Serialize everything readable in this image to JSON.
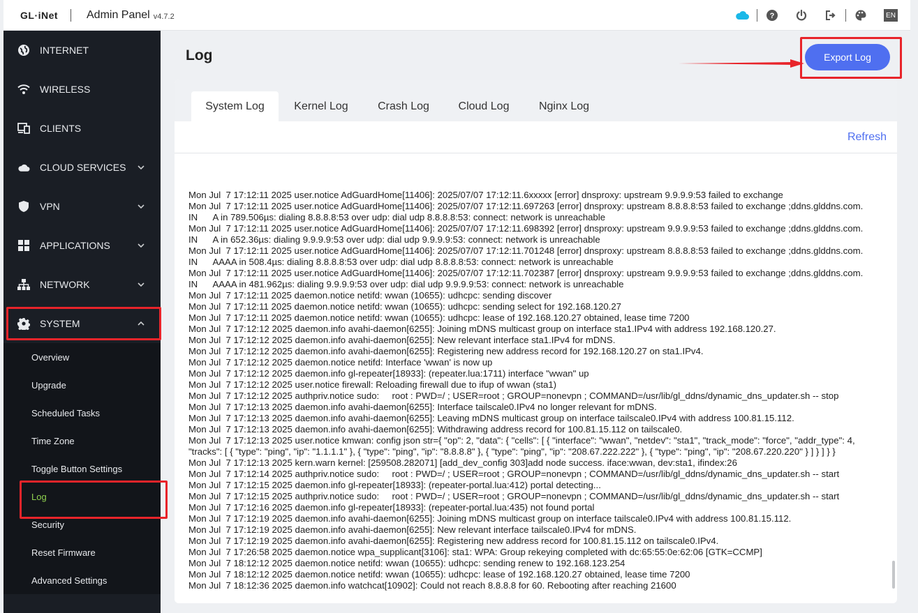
{
  "header": {
    "logo": "GL·iNet",
    "title": "Admin Panel",
    "version": "v4.7.2",
    "lang": "EN",
    "icons": [
      "cloud-icon",
      "help-icon",
      "power-icon",
      "logout-icon",
      "theme-icon"
    ],
    "cloud_color": "#1ab8e8"
  },
  "sidebar": {
    "items": [
      {
        "label": "INTERNET",
        "icon": "globe-icon"
      },
      {
        "label": "WIRELESS",
        "icon": "wifi-icon"
      },
      {
        "label": "CLIENTS",
        "icon": "devices-icon"
      },
      {
        "label": "CLOUD SERVICES",
        "icon": "cloud-icon"
      },
      {
        "label": "VPN",
        "icon": "shield-icon"
      },
      {
        "label": "APPLICATIONS",
        "icon": "apps-icon"
      },
      {
        "label": "NETWORK",
        "icon": "network-icon"
      },
      {
        "label": "SYSTEM",
        "icon": "gear-icon"
      }
    ],
    "system_sub": [
      "Overview",
      "Upgrade",
      "Scheduled Tasks",
      "Time Zone",
      "Toggle Button Settings",
      "Log",
      "Security",
      "Reset Firmware",
      "Advanced Settings"
    ],
    "active_sub": "Log",
    "active_color": "#8fd14f"
  },
  "main": {
    "title": "Log",
    "export_label": "Export Log",
    "refresh_label": "Refresh",
    "tabs": [
      "System Log",
      "Kernel Log",
      "Crash Log",
      "Cloud Log",
      "Nginx Log"
    ],
    "active_tab": "System Log",
    "accent": "#4f6ff0"
  },
  "log": [
    "Mon Jul  7 17:12:11 2025 user.notice AdGuardHome[11406]: 2025/07/07 17:12:11.6xxxxx [error] dnsproxy: upstream 9.9.9.9:53 failed to exchange",
    "Mon Jul  7 17:12:11 2025 user.notice AdGuardHome[11406]: 2025/07/07 17:12:11.697263 [error] dnsproxy: upstream 8.8.8.8:53 failed to exchange ;ddns.glddns.com.    IN      A in 789.506µs: dialing 8.8.8.8:53 over udp: dial udp 8.8.8.8:53: connect: network is unreachable",
    "Mon Jul  7 17:12:11 2025 user.notice AdGuardHome[11406]: 2025/07/07 17:12:11.698392 [error] dnsproxy: upstream 9.9.9.9:53 failed to exchange ;ddns.glddns.com.    IN      A in 652.36µs: dialing 9.9.9.9:53 over udp: dial udp 9.9.9.9:53: connect: network is unreachable",
    "Mon Jul  7 17:12:11 2025 user.notice AdGuardHome[11406]: 2025/07/07 17:12:11.701248 [error] dnsproxy: upstream 8.8.8.8:53 failed to exchange ;ddns.glddns.com.    IN      AAAA in 508.4µs: dialing 8.8.8.8:53 over udp: dial udp 8.8.8.8:53: connect: network is unreachable",
    "Mon Jul  7 17:12:11 2025 user.notice AdGuardHome[11406]: 2025/07/07 17:12:11.702387 [error] dnsproxy: upstream 9.9.9.9:53 failed to exchange ;ddns.glddns.com.    IN      AAAA in 481.962µs: dialing 9.9.9.9:53 over udp: dial udp 9.9.9.9:53: connect: network is unreachable",
    "Mon Jul  7 17:12:11 2025 daemon.notice netifd: wwan (10655): udhcpc: sending discover",
    "Mon Jul  7 17:12:11 2025 daemon.notice netifd: wwan (10655): udhcpc: sending select for 192.168.120.27",
    "Mon Jul  7 17:12:11 2025 daemon.notice netifd: wwan (10655): udhcpc: lease of 192.168.120.27 obtained, lease time 7200",
    "Mon Jul  7 17:12:12 2025 daemon.info avahi-daemon[6255]: Joining mDNS multicast group on interface sta1.IPv4 with address 192.168.120.27.",
    "Mon Jul  7 17:12:12 2025 daemon.info avahi-daemon[6255]: New relevant interface sta1.IPv4 for mDNS.",
    "Mon Jul  7 17:12:12 2025 daemon.info avahi-daemon[6255]: Registering new address record for 192.168.120.27 on sta1.IPv4.",
    "Mon Jul  7 17:12:12 2025 daemon.notice netifd: Interface 'wwan' is now up",
    "Mon Jul  7 17:12:12 2025 daemon.info gl-repeater[18933]: (repeater.lua:1711) interface \"wwan\" up",
    "Mon Jul  7 17:12:12 2025 user.notice firewall: Reloading firewall due to ifup of wwan (sta1)",
    "Mon Jul  7 17:12:12 2025 authpriv.notice sudo:     root : PWD=/ ; USER=root ; GROUP=nonevpn ; COMMAND=/usr/lib/gl_ddns/dynamic_dns_updater.sh -- stop",
    "Mon Jul  7 17:12:13 2025 daemon.info avahi-daemon[6255]: Interface tailscale0.IPv4 no longer relevant for mDNS.",
    "Mon Jul  7 17:12:13 2025 daemon.info avahi-daemon[6255]: Leaving mDNS multicast group on interface tailscale0.IPv4 with address 100.81.15.112.",
    "Mon Jul  7 17:12:13 2025 daemon.info avahi-daemon[6255]: Withdrawing address record for 100.81.15.112 on tailscale0.",
    "Mon Jul  7 17:12:13 2025 user.notice kmwan: config json str={ \"op\": 2, \"data\": { \"cells\": [ { \"interface\": \"wwan\", \"netdev\": \"sta1\", \"track_mode\": \"force\", \"addr_type\": 4, \"tracks\": [ { \"type\": \"ping\", \"ip\": \"1.1.1.1\" }, { \"type\": \"ping\", \"ip\": \"8.8.8.8\" }, { \"type\": \"ping\", \"ip\": \"208.67.222.222\" }, { \"type\": \"ping\", \"ip\": \"208.67.220.220\" } ] } ] } }",
    "Mon Jul  7 17:12:13 2025 kern.warn kernel: [259508.282071] [add_dev_config 303]add node success. iface:wwan, dev:sta1, ifindex:26",
    "Mon Jul  7 17:12:14 2025 authpriv.notice sudo:     root : PWD=/ ; USER=root ; GROUP=nonevpn ; COMMAND=/usr/lib/gl_ddns/dynamic_dns_updater.sh -- start",
    "Mon Jul  7 17:12:15 2025 daemon.info gl-repeater[18933]: (repeater-portal.lua:412) portal detecting...",
    "Mon Jul  7 17:12:15 2025 authpriv.notice sudo:     root : PWD=/ ; USER=root ; GROUP=nonevpn ; COMMAND=/usr/lib/gl_ddns/dynamic_dns_updater.sh -- start",
    "Mon Jul  7 17:12:16 2025 daemon.info gl-repeater[18933]: (repeater-portal.lua:435) not found portal",
    "Mon Jul  7 17:12:19 2025 daemon.info avahi-daemon[6255]: Joining mDNS multicast group on interface tailscale0.IPv4 with address 100.81.15.112.",
    "Mon Jul  7 17:12:19 2025 daemon.info avahi-daemon[6255]: New relevant interface tailscale0.IPv4 for mDNS.",
    "Mon Jul  7 17:12:19 2025 daemon.info avahi-daemon[6255]: Registering new address record for 100.81.15.112 on tailscale0.IPv4.",
    "Mon Jul  7 17:26:58 2025 daemon.notice wpa_supplicant[3106]: sta1: WPA: Group rekeying completed with dc:65:55:0e:62:06 [GTK=CCMP]",
    "Mon Jul  7 18:12:12 2025 daemon.notice netifd: wwan (10655): udhcpc: sending renew to 192.168.123.254",
    "Mon Jul  7 18:12:12 2025 daemon.notice netifd: wwan (10655): udhcpc: lease of 192.168.120.27 obtained, lease time 7200",
    "Mon Jul  7 18:12:36 2025 daemon.info watchcat[10902]: Could not reach 8.8.8.8 for 60. Rebooting after reaching 21600"
  ]
}
